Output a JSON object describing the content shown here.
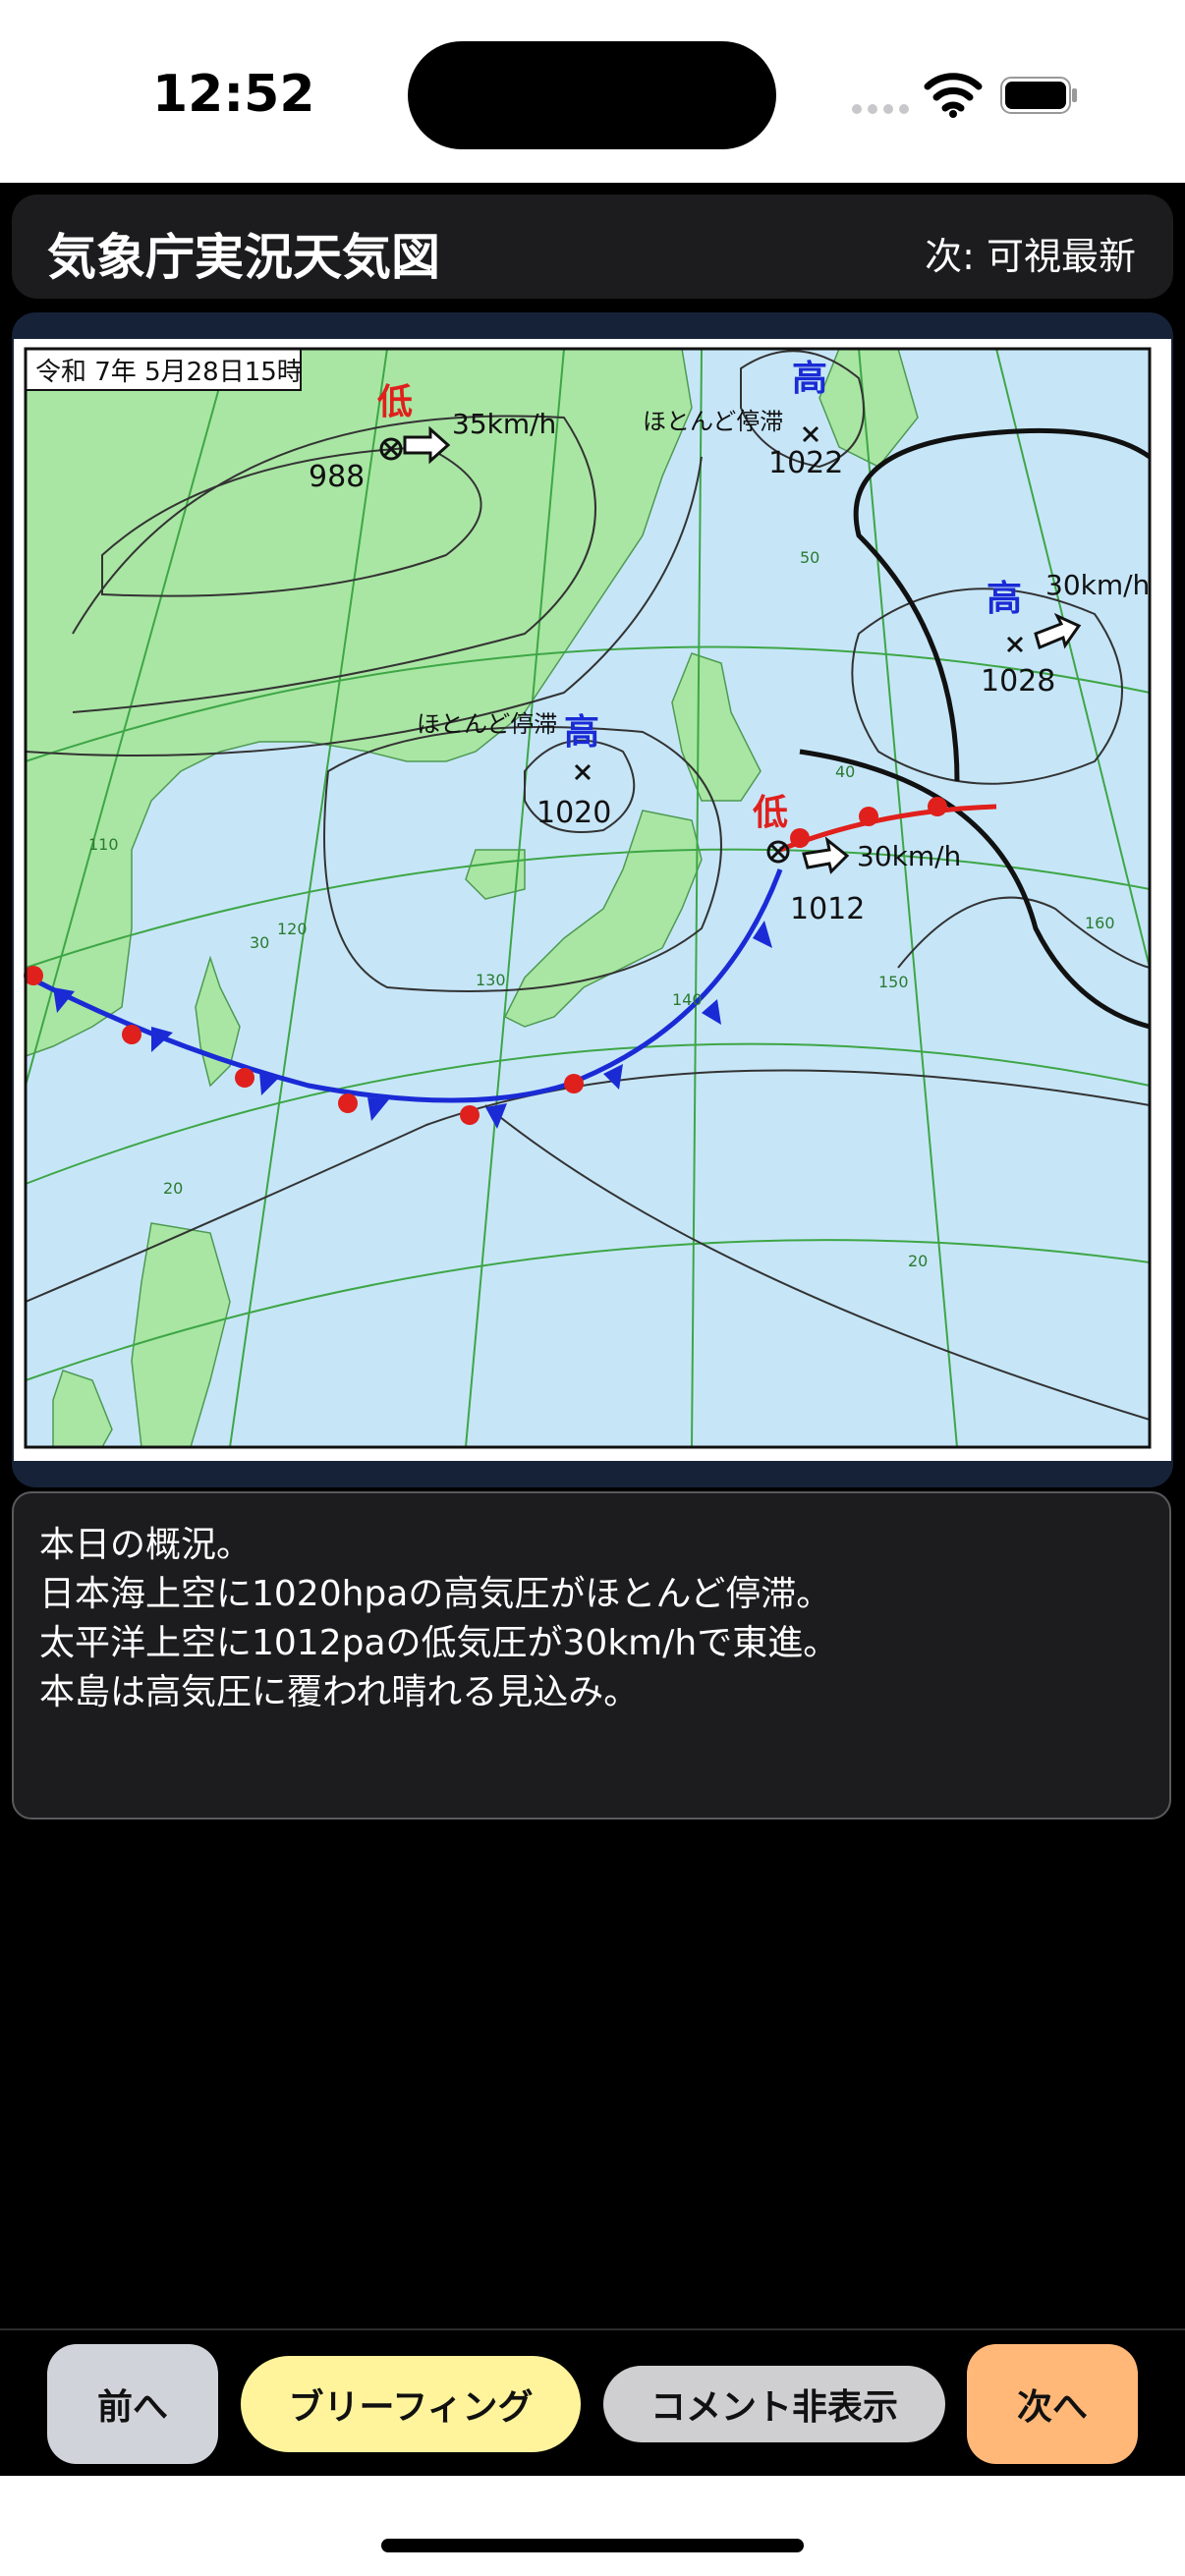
{
  "status": {
    "time": "12:52"
  },
  "header": {
    "title": "気象庁実況天気図",
    "next_label": "次: 可視最新"
  },
  "map": {
    "date_label": "令和 7年 5月28日15時",
    "systems": [
      {
        "kind": "低",
        "pressure": "988",
        "speed": "35km/h",
        "color": "#e0201c"
      },
      {
        "kind": "高",
        "pressure": "1022",
        "speed": "ほとんど停滞",
        "color": "#1a2bd6"
      },
      {
        "kind": "高",
        "pressure": "1028",
        "speed": "30km/h",
        "color": "#1a2bd6"
      },
      {
        "kind": "高",
        "pressure": "1020",
        "speed": "ほとんど停滞",
        "color": "#1a2bd6"
      },
      {
        "kind": "低",
        "pressure": "1012",
        "speed": "30km/h",
        "color": "#e0201c"
      }
    ],
    "grid_labels": [
      "50",
      "40",
      "110",
      "30",
      "120",
      "130",
      "140",
      "150",
      "160",
      "20",
      "20"
    ],
    "colors": {
      "sea": "#c6e6f8",
      "land": "#a9e6a3",
      "grid": "#3ea646",
      "isobar": "#333333",
      "warm_front": "#e0201c",
      "cold_front": "#1a2bd6"
    }
  },
  "comment": {
    "lines": [
      "本日の概況。",
      "日本海上空に1020hpaの高気圧がほとんど停滞。",
      "太平洋上空に1012paの低気圧が30km/hで東進。",
      "本島は高気圧に覆われ晴れる見込み。"
    ]
  },
  "buttons": {
    "prev": "前へ",
    "briefing": "ブリーフィング",
    "toggle_comment": "コメント非表示",
    "next": "次へ"
  }
}
